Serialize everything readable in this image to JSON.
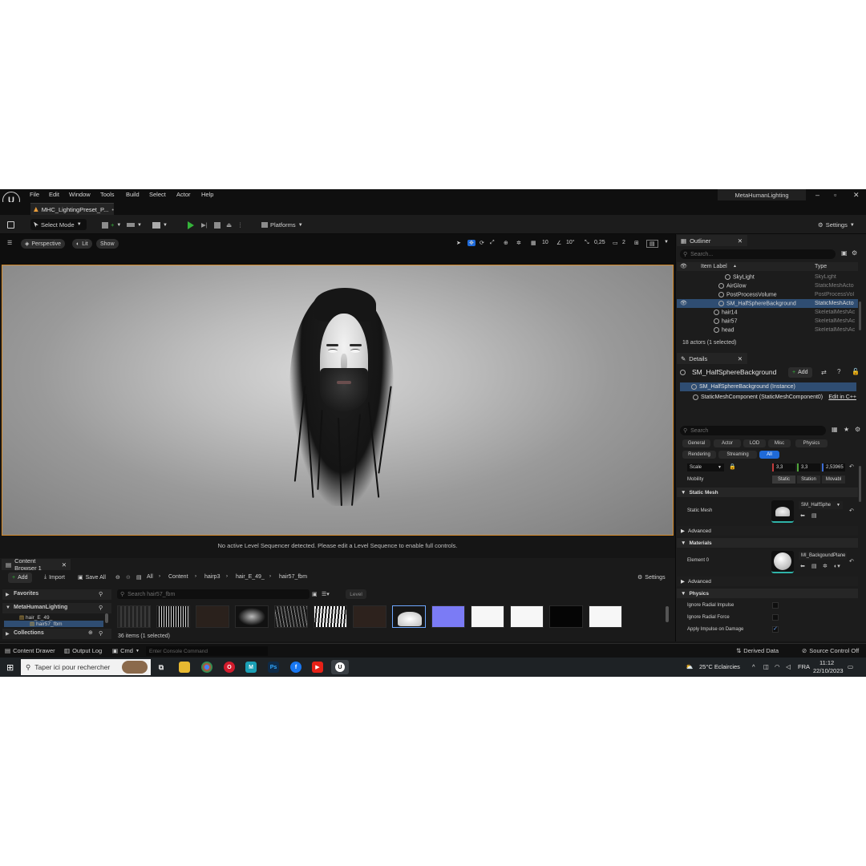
{
  "menu": {
    "items": [
      "File",
      "Edit",
      "Window",
      "Tools",
      "Build",
      "Select",
      "Actor",
      "Help"
    ],
    "project_title": "MetaHumanLighting"
  },
  "document_tab": {
    "label": "MHC_LightingPreset_P..."
  },
  "toolbar": {
    "select_mode": "Select Mode",
    "platforms": "Platforms",
    "settings": "Settings"
  },
  "viewport": {
    "perspective": "Perspective",
    "lit": "Lit",
    "show": "Show",
    "grid_snap": "10",
    "rot_snap": "10°",
    "scale_snap": "0,25",
    "camera_speed": "2",
    "sequencer_message": "No active Level Sequencer detected. Please edit a Level Sequence to enable full controls."
  },
  "outliner": {
    "tab": "Outliner",
    "search_placeholder": "Search...",
    "col_label": "Item Label",
    "col_type": "Type",
    "rows": [
      {
        "label": "SkyLight",
        "type": "SkyLight"
      },
      {
        "label": "AirGlow",
        "type": "StaticMeshActo"
      },
      {
        "label": "PostProcessVolume",
        "type": "PostProcessVol"
      },
      {
        "label": "SM_HalfSphereBackground",
        "type": "StaticMeshActo"
      },
      {
        "label": "hair14",
        "type": "SkeletalMeshAc"
      },
      {
        "label": "hair57",
        "type": "SkeletalMeshAc"
      },
      {
        "label": "head",
        "type": "SkeletalMeshAc"
      }
    ],
    "status": "18 actors (1 selected)"
  },
  "details": {
    "tab": "Details",
    "actor_name": "SM_HalfSphereBackground",
    "add_label": "Add",
    "instance_row": "SM_HalfSphereBackground (Instance)",
    "component_row": "StaticMeshComponent (StaticMeshComponent0)",
    "edit_in_cpp": "Edit in C++",
    "search_placeholder": "Search",
    "categories_row1": [
      "General",
      "Actor",
      "LOD",
      "Misc",
      "Physics"
    ],
    "categories_row2": [
      "Rendering",
      "Streaming",
      "All"
    ],
    "scale_label": "Scale",
    "scale_values": [
      "3,3",
      "3,3",
      "2,53965"
    ],
    "mobility_label": "Mobility",
    "mobility_options": [
      "Static",
      "Station",
      "Movabl"
    ],
    "sec_static_mesh": "Static Mesh",
    "static_mesh_label": "Static Mesh",
    "static_mesh_value": "SM_HalfSphe",
    "advanced_1": "Advanced",
    "sec_materials": "Materials",
    "element0_label": "Element 0",
    "element0_value": "MI_BackgoundPlane",
    "advanced_2": "Advanced",
    "sec_physics": "Physics",
    "physics_props": [
      {
        "label": "Ignore Radial Impulse",
        "checked": false
      },
      {
        "label": "Ignore Radial Force",
        "checked": false
      },
      {
        "label": "Apply Impulse on Damage",
        "checked": true
      }
    ]
  },
  "content_browser": {
    "tab": "Content Browser 1",
    "add_label": "Add",
    "import_label": "Import",
    "save_all_label": "Save All",
    "breadcrumb": [
      "All",
      "Content",
      "hairp3",
      "hair_E_49_",
      "hair57_fbm"
    ],
    "settings_label": "Settings",
    "favorites": "Favorites",
    "project": "MetaHumanLighting",
    "tree_items": [
      "hair_E_49_",
      "hair57_fbm"
    ],
    "collections": "Collections",
    "search_placeholder": "Search hair57_fbm",
    "level_filter": "Level",
    "status": "36 items (1 selected)",
    "thumbs": [
      "dark",
      "stripes",
      "brown",
      "black-dots",
      "stripes",
      "bw",
      "brown",
      "mesh",
      "blue",
      "white",
      "white",
      "black",
      "white"
    ]
  },
  "statusbar": {
    "content_drawer": "Content Drawer",
    "output_log": "Output Log",
    "cmd": "Cmd",
    "console_placeholder": "Enter Console Command",
    "derived_data": "Derived Data",
    "source_control": "Source Control Off"
  },
  "taskbar": {
    "search_placeholder": "Taper ici pour rechercher",
    "weather": "25°C  Eclaircies",
    "lang": "FRA",
    "time": "11:12",
    "date": "22/10/2023"
  },
  "colors": {
    "accent_blue": "#1f6ad8",
    "selection": "#2f4d72",
    "play_green": "#35b33a",
    "viewport_border": "#d48a2a"
  }
}
